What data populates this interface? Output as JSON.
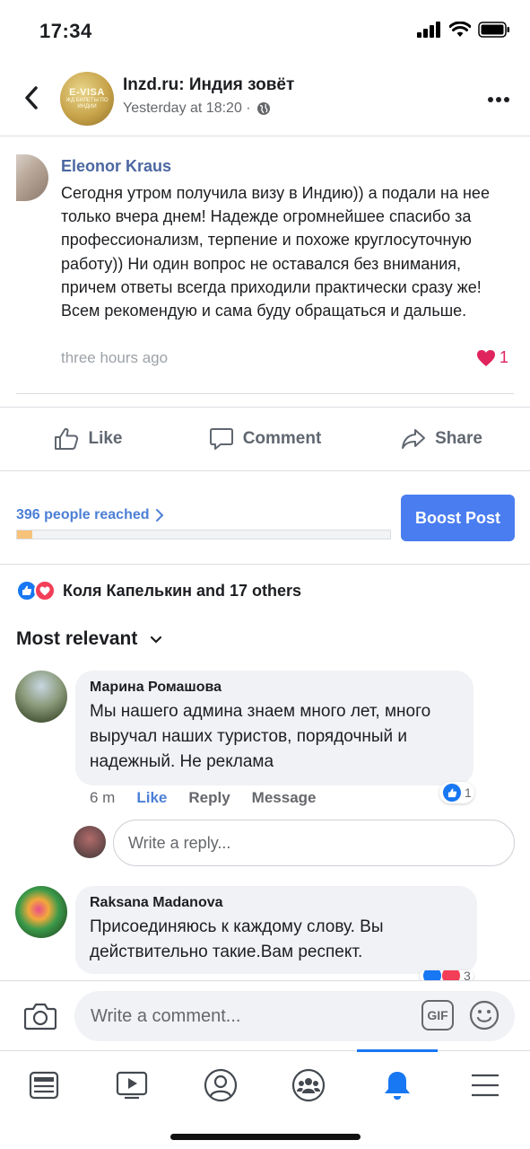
{
  "status_bar": {
    "time": "17:34"
  },
  "header": {
    "title": "Inzd.ru: Индия зовёт",
    "subtitle": "Yesterday at 18:20 ·",
    "avatar_text_top": "E-VISA",
    "avatar_text_bottom": "ЖД БИЛЕТЫ ПО ИНДИИ"
  },
  "post": {
    "author": "Eleonor Kraus",
    "text": "Сегодня утром получила визу в Индию)) а подали на нее только вчера днем! Надежде огромнейшее спасибо за профессионализм, терпение и похоже круглосуточную работу)) Ни один вопрос не оставался без внимания, причем ответы всегда приходили практически сразу же!  Всем рекомендую и сама буду обращаться и дальше.",
    "time": "three hours ago",
    "like_count": "1"
  },
  "actions": {
    "like": "Like",
    "comment": "Comment",
    "share": "Share"
  },
  "reach": {
    "label": "396 people reached",
    "fill_fraction": 0.04,
    "boost_label": "Boost Post"
  },
  "reactions": {
    "summary": "Коля Капелькин and 17 others"
  },
  "sort": {
    "label": "Most relevant"
  },
  "comments": [
    {
      "name": "Марина Ромашова",
      "text": "Мы нашего админа знаем много лет, много выручал наших туристов, порядочный и надежный. Не реклама",
      "time": "6 m",
      "like": "Like",
      "reply": "Reply",
      "message": "Message",
      "reaction_count": "1"
    },
    {
      "name": "Raksana Madanova",
      "text": "Присоединяюсь к каждому слову. Вы действительно такие.Вам респект.",
      "reaction_count": "3"
    }
  ],
  "reply_input": {
    "placeholder": "Write a reply..."
  },
  "composer": {
    "placeholder": "Write a comment...",
    "gif": "GIF"
  },
  "colors": {
    "accent": "#4a7df0",
    "link": "#4c7fd6",
    "like_blue": "#1877f2",
    "love_red": "#f33e58"
  },
  "tabs": [
    "news-feed-icon",
    "watch-icon",
    "profile-icon",
    "groups-icon",
    "notifications-icon",
    "menu-icon"
  ]
}
